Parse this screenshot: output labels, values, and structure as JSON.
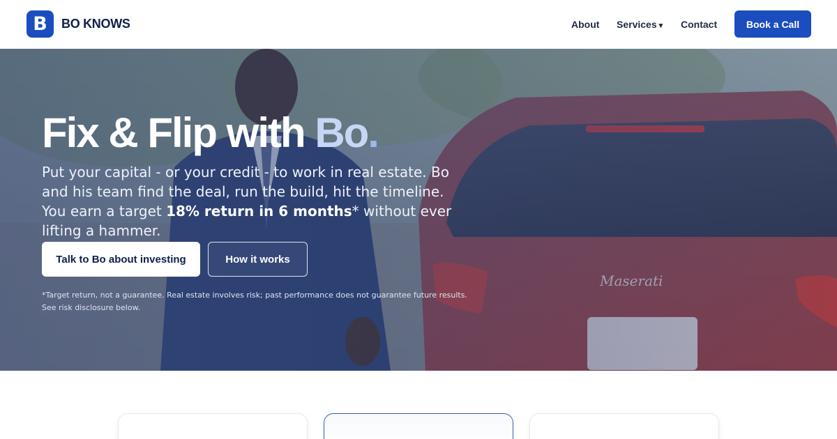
{
  "brand": {
    "logo_letter": "B",
    "name": "BO KNOWS",
    "accent_color": "#1b4dbf"
  },
  "nav": {
    "about": "About",
    "services": "Services",
    "services_caret": "▾",
    "contact": "Contact",
    "cta": "Book a Call"
  },
  "hero": {
    "title_main": "Fix & Flip with ",
    "title_accent": "Bo",
    "title_dot": ".",
    "subtitle_part1": "Put your capital - or your credit - to work in real estate. Bo and his team find the deal, run the build, hit the timeline. You earn a target ",
    "subtitle_bold": "18% return in 6 months",
    "subtitle_part2": "* without ever lifting a hammer.",
    "primary_cta": "Talk to Bo about investing",
    "secondary_cta": "How it works",
    "disclaimer_line1": "*Target return, not a guarantee. Real estate involves risk; past performance does not guarantee future results.",
    "disclaimer_line2": "See risk disclosure below."
  }
}
